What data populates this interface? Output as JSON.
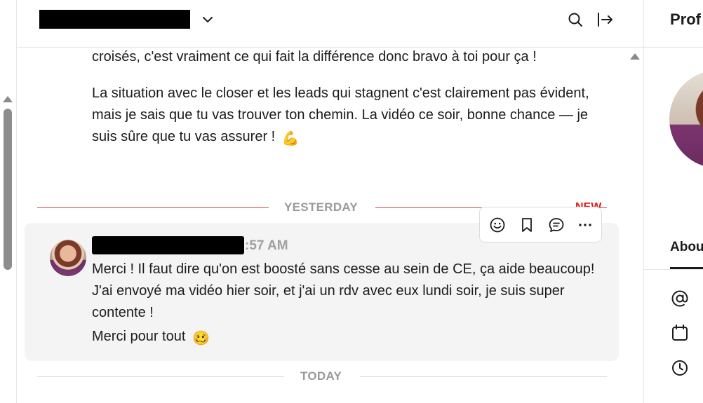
{
  "header": {
    "chevron_icon": "chevron-down-icon",
    "search_icon": "search-icon",
    "exit_icon": "arrow-right-to-bar-icon"
  },
  "previous_message": {
    "paragraph1": "croisés, c'est vraiment ce qui fait la différence donc bravo à toi pour ça !",
    "paragraph2": "La situation avec le closer et les leads qui stagnent c'est clairement pas évident, mais je sais que tu vas trouver ton chemin. La vidéo ce soir, bonne chance — je suis sûre que tu vas assurer !",
    "emoji": "💪"
  },
  "divider_yesterday": {
    "label": "YESTERDAY",
    "new_badge": "NEW"
  },
  "hovered_message": {
    "time": ":57 AM",
    "paragraph1": "Merci ! Il faut dire qu'on est boosté sans cesse au sein de CE, ça aide beaucoup! J'ai envoyé ma vidéo hier soir, et j'ai un rdv avec eux lundi soir, je suis super contente !",
    "paragraph2": "Merci pour tout",
    "emoji": "🥴"
  },
  "message_toolbar": {
    "icons": [
      "add-reaction-icon",
      "bookmark-icon",
      "reply-in-thread-icon",
      "more-actions-icon"
    ]
  },
  "divider_today": {
    "label": "TODAY"
  },
  "profile_panel": {
    "title": "Prof",
    "tab_about": "Abou",
    "icons": [
      "at-sign-icon",
      "calendar-icon",
      "clock-icon"
    ]
  },
  "colors": {
    "new_divider": "#c94a4a",
    "new_badge": "#e01e1e",
    "hover_background": "#f4f4f4"
  }
}
